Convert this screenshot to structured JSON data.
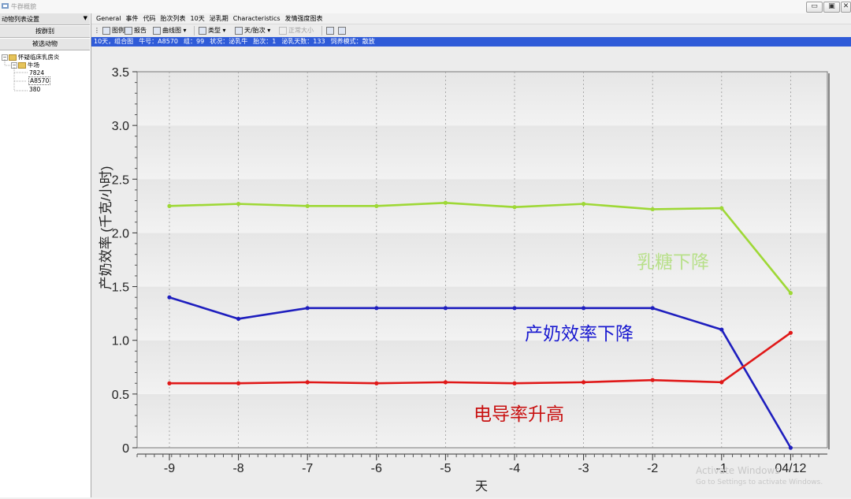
{
  "window": {
    "title": "牛群概貌",
    "min": "▭",
    "max": "▣",
    "close": "✕"
  },
  "sidebar": {
    "dropdown_label": "动物列表设置",
    "buttons": [
      "按群别",
      "被选动物"
    ],
    "tree": {
      "root": "怀疑临床乳房炎",
      "group": "牛场",
      "animals": [
        "7824",
        "A8570",
        "380"
      ]
    }
  },
  "menu": [
    "General",
    "事件",
    "代码",
    "胎次列表",
    "10天",
    "泌乳期",
    "Characteristics",
    "发情强度图表"
  ],
  "toolbar": {
    "legend": "图例",
    "report": "报告",
    "curve": "曲线图",
    "type": "类型",
    "day_parity": "天/胎次",
    "normal_size": "正常大小"
  },
  "infobar": [
    "10天，组合图",
    "牛号：A8570",
    "组：99",
    "状况：泌乳牛",
    "胎次：1",
    "泌乳天数：133",
    "饲养模式：散放"
  ],
  "chart_data": {
    "type": "line",
    "x": [
      "-9",
      "-8",
      "-7",
      "-6",
      "-5",
      "-4",
      "-3",
      "-2",
      "-1",
      "04/12"
    ],
    "ylabel": "产奶效率 (千克/小时)",
    "xlabel": "天",
    "ylim": [
      0,
      3.5
    ],
    "yticks": [
      "0",
      "0.5",
      "1.0",
      "1.5",
      "2.0",
      "2.5",
      "3.0",
      "3.5"
    ],
    "grid": "horizontal bands",
    "series": [
      {
        "color": "#9ed836",
        "values": [
          2.25,
          2.27,
          2.25,
          2.25,
          2.28,
          2.24,
          2.27,
          2.22,
          2.23,
          1.44
        ]
      },
      {
        "color": "#1e1ebe",
        "values": [
          1.4,
          1.2,
          1.3,
          1.3,
          1.3,
          1.3,
          1.3,
          1.3,
          1.1,
          0.0
        ]
      },
      {
        "color": "#e01818",
        "values": [
          0.6,
          0.6,
          0.61,
          0.6,
          0.61,
          0.6,
          0.61,
          0.63,
          0.61,
          1.07
        ]
      }
    ],
    "annotations": [
      {
        "text": "乳糖下降",
        "color": "#b8e08a"
      },
      {
        "text": "产奶效率下降",
        "color": "#1a1ad0"
      },
      {
        "text": "电导率升高",
        "color": "#c81010"
      }
    ]
  },
  "watermark": [
    "Activate Windows",
    "Go to Settings to activate Windows."
  ]
}
